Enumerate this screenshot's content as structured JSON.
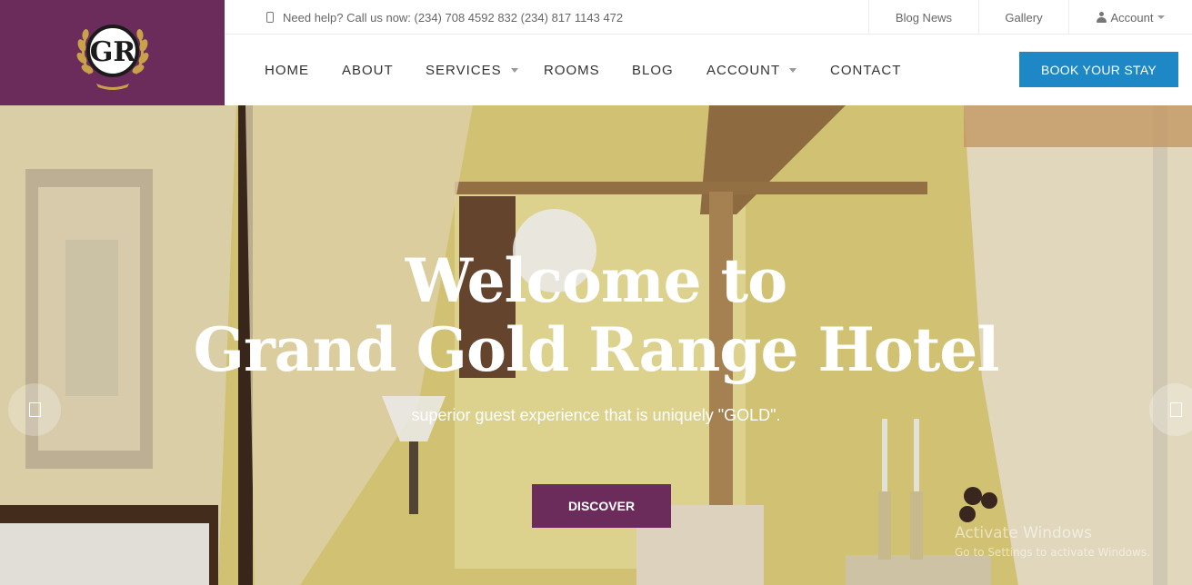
{
  "brand": {
    "logo_text": "GR",
    "logo_background": "#6b2c5c"
  },
  "topbar": {
    "help_icon": "phone-icon",
    "help_text": "Need help? Call us now: (234) 708 4592 832 (234) 817 1143 472",
    "links": [
      {
        "label": "Blog News"
      },
      {
        "label": "Gallery"
      },
      {
        "label": "Account",
        "icon": "user-icon"
      }
    ]
  },
  "nav": {
    "items": [
      {
        "label": "HOME",
        "dropdown": false
      },
      {
        "label": "ABOUT",
        "dropdown": false
      },
      {
        "label": "SERVICES",
        "dropdown": true
      },
      {
        "label": "ROOMS",
        "dropdown": false
      },
      {
        "label": "BLOG",
        "dropdown": false
      },
      {
        "label": "ACCOUNT",
        "dropdown": true
      },
      {
        "label": "CONTACT",
        "dropdown": false
      }
    ],
    "cta_label": "BOOK YOUR STAY",
    "cta_color": "#1e88c7"
  },
  "hero": {
    "title_line1": "Welcome to",
    "title_line2": "Grand Gold Range Hotel",
    "subtitle": "superior guest experience that is uniquely \"GOLD\".",
    "button_label": "DISCOVER",
    "button_color": "#6b2c5c",
    "prev_icon": "chevron-left-icon",
    "next_icon": "chevron-right-icon"
  },
  "watermark": {
    "line1": "Activate Windows",
    "line2": "Go to Settings to activate Windows."
  }
}
